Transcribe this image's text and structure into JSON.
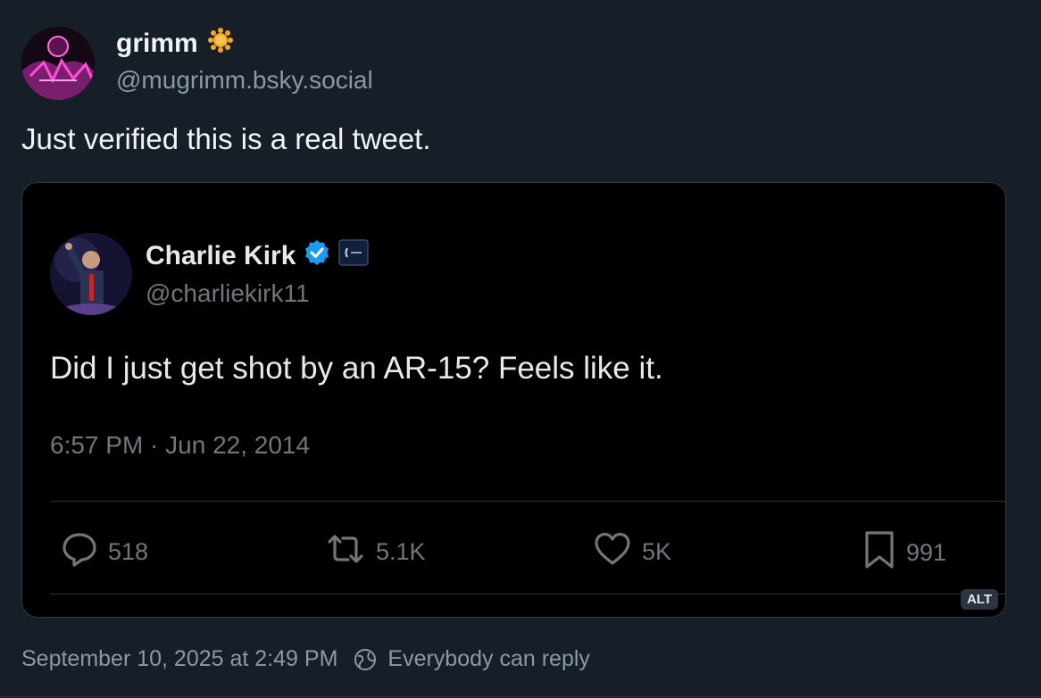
{
  "post": {
    "author_name": "grimm",
    "author_handle": "@mugrimm.bsky.social",
    "text": "Just verified this is a real tweet.",
    "timestamp": "September 10, 2025 at 2:49 PM",
    "reply_setting": "Everybody can reply"
  },
  "embed": {
    "name": "Charlie Kirk",
    "handle": "@charliekirk11",
    "text": "Did I just get shot by an AR-15? Feels like it.",
    "time": "6:57 PM · Jun 22, 2014",
    "replies": "518",
    "retweets": "5.1K",
    "likes": "5K",
    "bookmarks": "991",
    "alt_label": "ALT"
  },
  "colors": {
    "background": "#161e27",
    "verified": "#1d9bf0",
    "badge": "#f5a623"
  },
  "icons": {
    "author_badge": "sun-badge-icon",
    "verified": "verified-check-icon",
    "affiliate": "affiliate-badge-icon",
    "reply": "reply-icon",
    "retweet": "retweet-icon",
    "like": "heart-icon",
    "bookmark": "bookmark-icon",
    "reply_setting": "globe-icon"
  }
}
